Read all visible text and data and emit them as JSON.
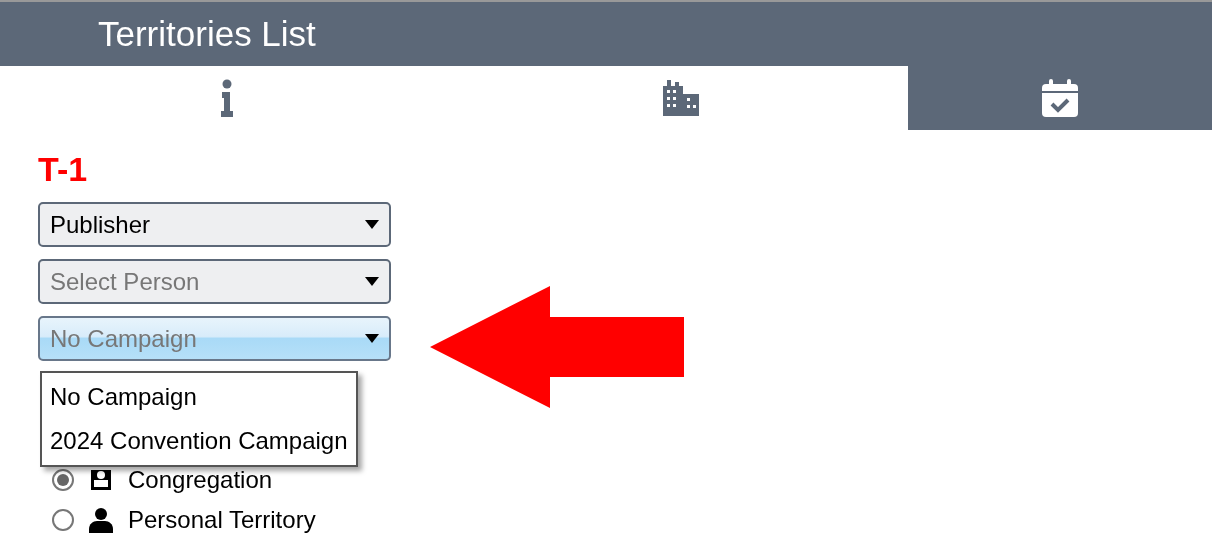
{
  "header": {
    "title": "Territories List"
  },
  "tabs": [
    {
      "selected": false
    },
    {
      "selected": false
    },
    {
      "selected": true
    }
  ],
  "territory": {
    "code": "T-1"
  },
  "dropdowns": [
    {
      "value": "Publisher",
      "placeholder_shown": false,
      "focused": false
    },
    {
      "value": "Select Person",
      "placeholder_shown": true,
      "focused": false
    },
    {
      "value": "No Campaign",
      "placeholder_shown": true,
      "focused": true
    }
  ],
  "dropdown_menu": {
    "options": [
      {
        "label": "No Campaign"
      },
      {
        "label": "2024 Convention Campaign"
      }
    ]
  },
  "radios": [
    {
      "label": "Congregation",
      "selected": true
    },
    {
      "label": "Personal Territory",
      "selected": false
    }
  ]
}
